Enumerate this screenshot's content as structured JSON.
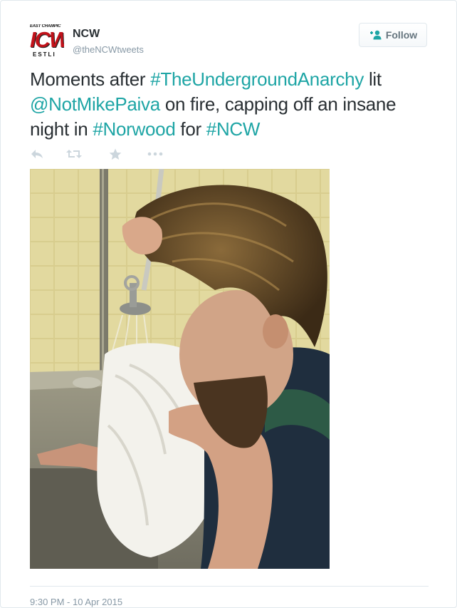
{
  "author": {
    "avatar": {
      "top_text": "EAST CHAMPIC",
      "big_text": "ICW",
      "bottom_text": "ESTLI"
    },
    "name": "NCW",
    "handle": "@theNCWtweets"
  },
  "follow_button": {
    "label": "Follow",
    "icon": "add-user-icon"
  },
  "tweet": {
    "segments": [
      {
        "text": "Moments after ",
        "link": false
      },
      {
        "text": "#TheUndergroundAnarchy",
        "link": true
      },
      {
        "text": " lit ",
        "link": false
      },
      {
        "text": "@NotMikePaiva",
        "link": true
      },
      {
        "text": " on fire, capping off an insane night in ",
        "link": false
      },
      {
        "text": "#Norwood",
        "link": true
      },
      {
        "text": " for ",
        "link": false
      },
      {
        "text": "#NCW",
        "link": true
      }
    ],
    "timestamp": "9:30 PM - 10 Apr 2015"
  },
  "actions": [
    {
      "name": "reply",
      "icon": "reply-icon"
    },
    {
      "name": "retweet",
      "icon": "retweet-icon"
    },
    {
      "name": "favorite",
      "icon": "star-icon"
    },
    {
      "name": "more",
      "icon": "more-icon"
    }
  ],
  "colors": {
    "link": "#1ea5a5",
    "text": "#292f33",
    "muted": "#8899a6",
    "icon": "#ccd6dd",
    "avatar_red": "#c1121a"
  }
}
